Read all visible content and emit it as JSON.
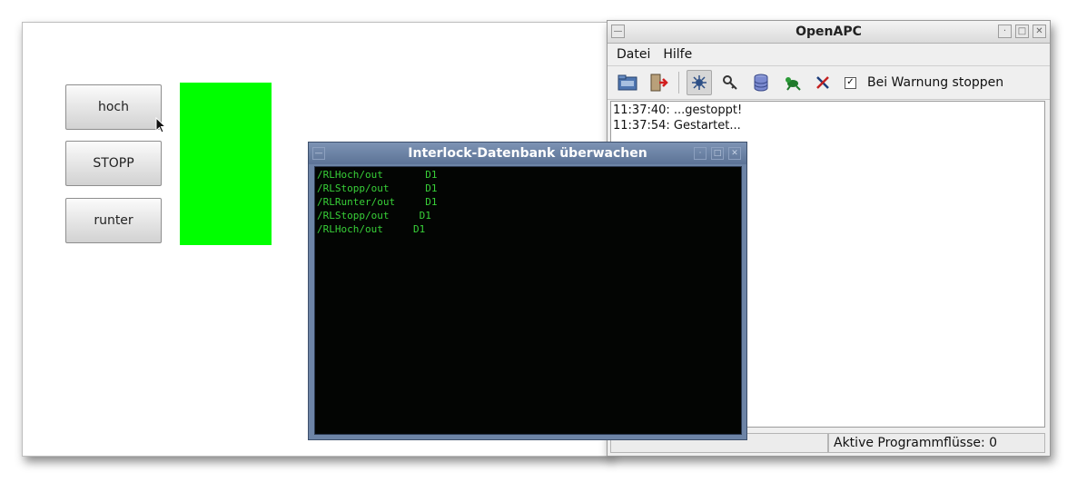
{
  "hmi": {
    "buttons": [
      {
        "label": "hoch"
      },
      {
        "label": "STOPP"
      },
      {
        "label": "runter"
      }
    ],
    "indicator_color": "#00ff00"
  },
  "openapc": {
    "title": "OpenAPC",
    "menu": [
      "Datei",
      "Hilfe"
    ],
    "toolbar_icons": [
      "open-folder-icon",
      "exit-icon",
      "bug-debug-icon",
      "magnifier-key-icon",
      "database-icon",
      "frog-icon",
      "tools-icon"
    ],
    "warn_checkbox": {
      "checked": true,
      "label": "Bei Warnung stoppen"
    },
    "log": [
      "11:37:40: ...gestoppt!",
      "11:37:54: Gestartet..."
    ],
    "status": {
      "active_flows": "Aktive Programmflüsse: 0"
    }
  },
  "monitor": {
    "title": "Interlock-Datenbank überwachen",
    "rows": [
      {
        "path": "/RLHoch/out",
        "gap": "       ",
        "value": "D1"
      },
      {
        "path": "/RLStopp/out",
        "gap": "      ",
        "value": "D1"
      },
      {
        "path": "/RLRunter/out",
        "gap": "     ",
        "value": "D1"
      },
      {
        "path": "/RLStopp/out",
        "gap": "     ",
        "value": "D1"
      },
      {
        "path": "/RLHoch/out",
        "gap": "     ",
        "value": "D1"
      }
    ],
    "text_color": "#38d038"
  }
}
